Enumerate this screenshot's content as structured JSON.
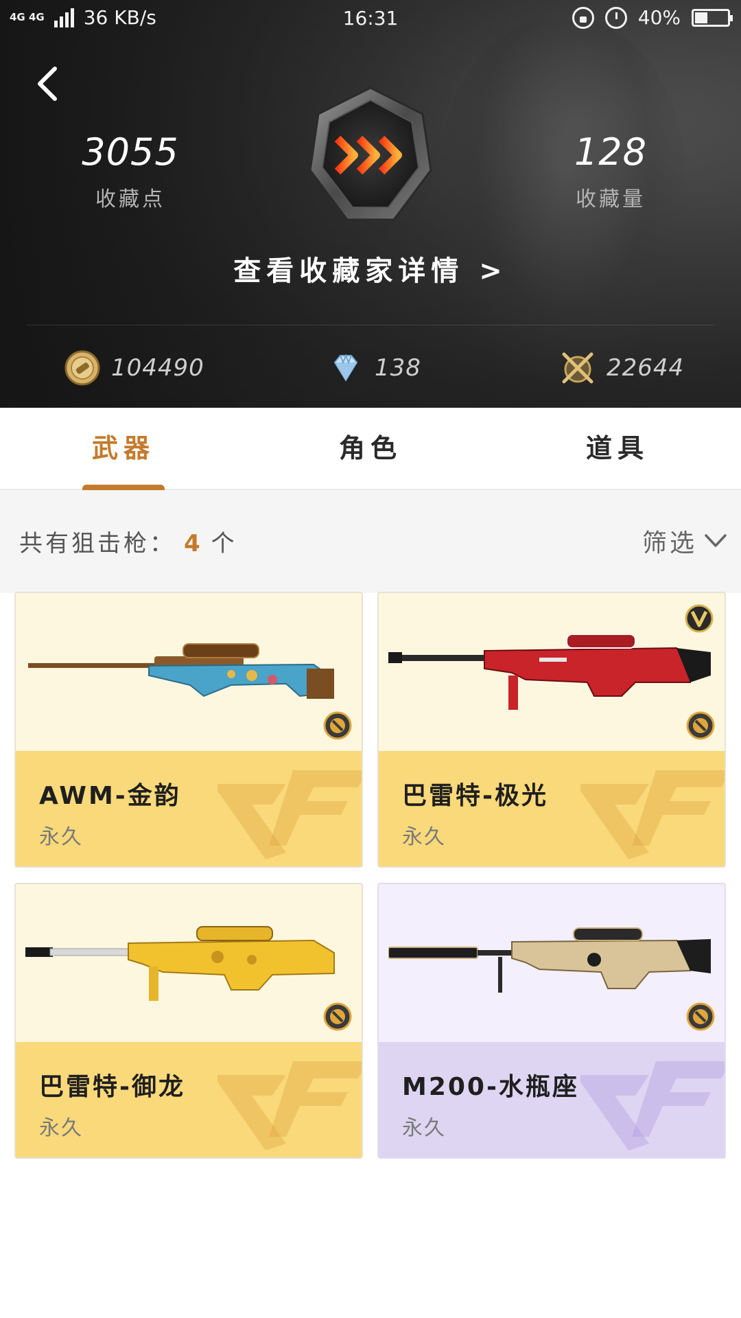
{
  "status_bar": {
    "network": "4G 4G",
    "speed": "36 KB/s",
    "time": "16:31",
    "battery": "40%",
    "battery_level": 0.4
  },
  "header": {
    "collect_points_value": "3055",
    "collect_points_label": "收藏点",
    "collect_count_value": "128",
    "collect_count_label": "收藏量",
    "detail_link": "查看收藏家详情 >"
  },
  "currency": {
    "coins": "104490",
    "diamonds": "138",
    "badges": "22644"
  },
  "tabs": [
    {
      "label": "武器",
      "active": true
    },
    {
      "label": "角色",
      "active": false
    },
    {
      "label": "道具",
      "active": false
    }
  ],
  "filter": {
    "count_prefix": "共有狙击枪：",
    "count_value": "4",
    "count_suffix": "个",
    "filter_label": "筛选"
  },
  "items": [
    {
      "name": "AWM-金韵",
      "duration": "永久",
      "theme": "gold",
      "vip": false
    },
    {
      "name": "巴雷特-极光",
      "duration": "永久",
      "theme": "gold",
      "vip": true
    },
    {
      "name": "巴雷特-御龙",
      "duration": "永久",
      "theme": "gold",
      "vip": false
    },
    {
      "name": "M200-水瓶座",
      "duration": "永久",
      "theme": "purple",
      "vip": false
    }
  ],
  "colors": {
    "accent": "#c47a2c",
    "card_gold": "#f9d97a",
    "card_purple": "#ddd5f1"
  },
  "icons": {
    "back": "chevron-left-icon",
    "coin": "coin-icon",
    "diamond": "diamond-icon",
    "badge": "crossed-guns-icon",
    "filter": "chevron-down-icon",
    "medal": "medal-icon",
    "vip": "v-badge-icon"
  }
}
